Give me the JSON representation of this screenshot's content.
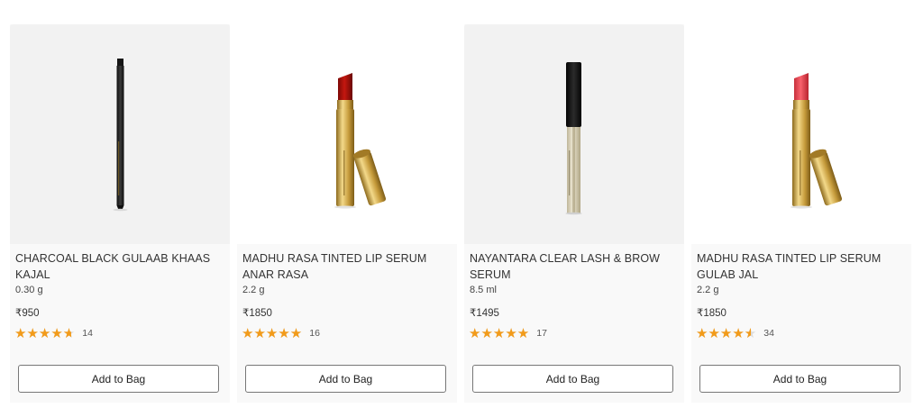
{
  "products": [
    {
      "title": "CHARCOAL BLACK GULAAB KHAAS KAJAL",
      "size": "0.30 g",
      "price": "₹950",
      "rating": 4.7,
      "review_count": "14",
      "button": "Add to Bag",
      "image_icon": "kajal-pencil-image",
      "bg": "grey"
    },
    {
      "title": "MADHU RASA TINTED LIP SERUM ANAR RASA",
      "size": "2.2 g",
      "price": "₹1850",
      "rating": 5.0,
      "review_count": "16",
      "button": "Add to Bag",
      "image_icon": "lip-serum-red-image",
      "bg": "white"
    },
    {
      "title": "NAYANTARA CLEAR LASH & BROW SERUM",
      "size": "8.5 ml",
      "price": "₹1495",
      "rating": 5.0,
      "review_count": "17",
      "button": "Add to Bag",
      "image_icon": "lash-serum-tube-image",
      "bg": "grey"
    },
    {
      "title": "MADHU RASA TINTED LIP SERUM GULAB JAL",
      "size": "2.2 g",
      "price": "₹1850",
      "rating": 4.5,
      "review_count": "34",
      "button": "Add to Bag",
      "image_icon": "lip-serum-pink-image",
      "bg": "white"
    }
  ],
  "colors": {
    "star": "#f29b1a",
    "card_bg": "#f9f9f9",
    "image_grey": "#f2f2f2",
    "gold": "#c9a548",
    "red_bullet": "#b5140f",
    "pink_bullet": "#ef4e5a"
  }
}
